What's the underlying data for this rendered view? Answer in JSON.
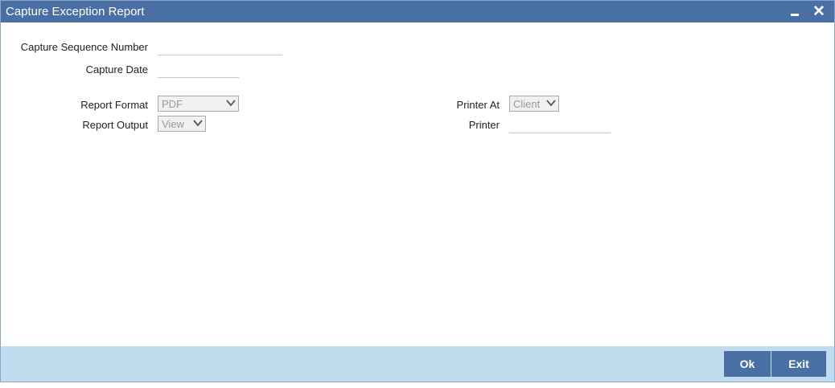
{
  "window": {
    "title": "Capture Exception Report"
  },
  "form": {
    "capture_sequence_number": {
      "label": "Capture Sequence Number",
      "value": ""
    },
    "capture_date": {
      "label": "Capture Date",
      "value": ""
    },
    "report_format": {
      "label": "Report Format",
      "selected": "PDF"
    },
    "report_output": {
      "label": "Report Output",
      "selected": "View"
    },
    "printer_at": {
      "label": "Printer At",
      "selected": "Client"
    },
    "printer": {
      "label": "Printer",
      "value": ""
    }
  },
  "footer": {
    "ok_label": "Ok",
    "exit_label": "Exit"
  },
  "colors": {
    "titlebar": "#4a6fa5",
    "footer": "#c2dcef",
    "button": "#4a6fa5"
  },
  "icons": {
    "minimize": "minimize-icon",
    "close": "close-icon",
    "dropdown": "chevron-down-icon"
  }
}
